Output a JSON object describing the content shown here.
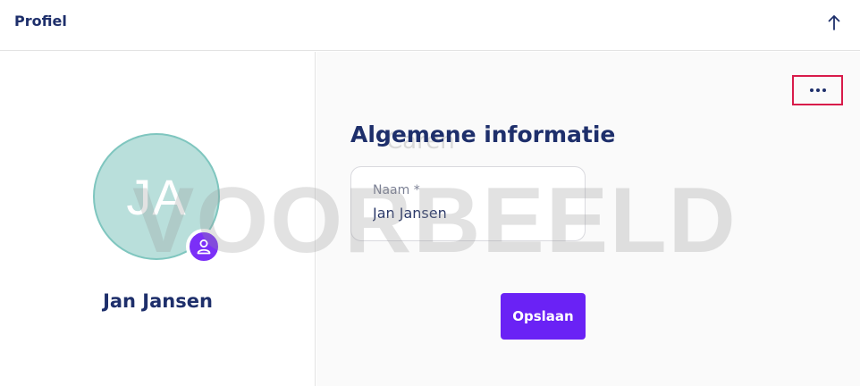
{
  "header": {
    "title": "Profiel",
    "collapse_icon": "arrow-up-icon"
  },
  "profile": {
    "initials": "JA",
    "name": "Jan Jansen",
    "badge_icon": "user-icon",
    "avatar_color": "#b9dfdb",
    "badge_color": "#7b2ff7"
  },
  "form": {
    "more_icon": "more-horizontal-icon",
    "ghost_text": "Caren",
    "title": "Algemene informatie",
    "name_field": {
      "label": "Naam *",
      "value": "Jan Jansen"
    },
    "save_label": "Opslaan",
    "accent_color": "#6a22f5"
  },
  "watermark": "VOORBEELD"
}
